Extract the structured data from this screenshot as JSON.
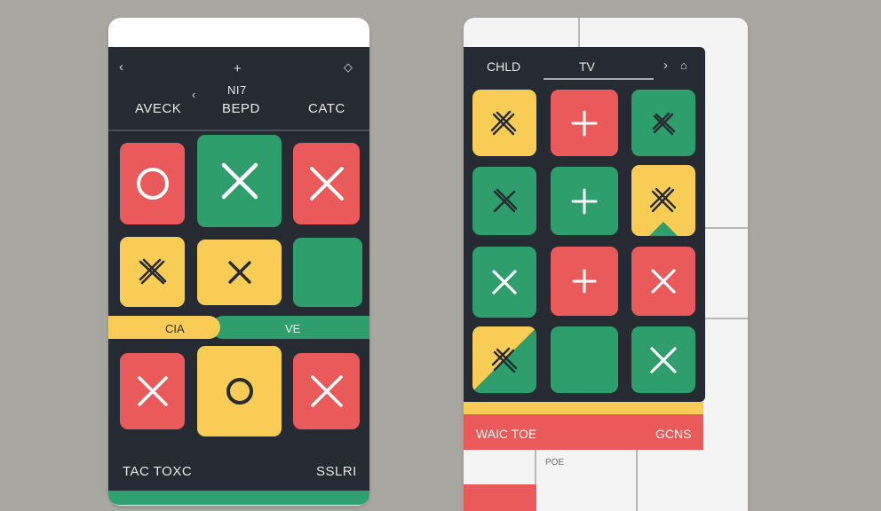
{
  "left_phone": {
    "header": {
      "top_icons": [
        "chevron-left-icon",
        "plus-icon",
        "diamond-icon"
      ],
      "center_text": "NI7",
      "small_icon": "chevron-left-icon",
      "tabs": [
        "AVECK",
        "BEPD",
        "CATC"
      ]
    },
    "board_rows": [
      [
        {
          "color": "red",
          "mark": "O"
        },
        {
          "color": "green",
          "mark": "X"
        },
        {
          "color": "red",
          "mark": "X"
        }
      ],
      [
        {
          "color": "yellow",
          "mark": "scribble-X"
        },
        {
          "color": "yellow",
          "mark": "x"
        },
        {
          "color": "green",
          "mark": ""
        }
      ],
      [
        {
          "color": "red",
          "mark": "X"
        },
        {
          "color": "yellow",
          "mark": "O"
        },
        {
          "color": "red",
          "mark": "X"
        }
      ]
    ],
    "band": {
      "left_label": "CIA",
      "right_label": "VE"
    },
    "footer": {
      "left_label": "TAC TOXC",
      "right_label": "SSLRI"
    }
  },
  "right_phone": {
    "header": {
      "left_label": "CHLD",
      "center_label": "TV",
      "icons": [
        "chevron-right-icon",
        "bell-icon"
      ]
    },
    "board_rows": [
      [
        {
          "color": "yellow",
          "mark": "scribble-X"
        },
        {
          "color": "red",
          "mark": "+"
        },
        {
          "color": "green",
          "mark": "scribble-X"
        }
      ],
      [
        {
          "color": "green",
          "mark": "scribble-X"
        },
        {
          "color": "green",
          "mark": "+"
        },
        {
          "color": "yellow",
          "mark": "scribble-X"
        }
      ],
      [
        {
          "color": "green",
          "mark": "X"
        },
        {
          "color": "red",
          "mark": "+"
        },
        {
          "color": "red",
          "mark": "X"
        }
      ],
      [
        {
          "color": "yellow-green",
          "mark": "scribble-X"
        },
        {
          "color": "green",
          "mark": ""
        },
        {
          "color": "green",
          "mark": "X"
        }
      ]
    ],
    "status_bar": {
      "left_label": "WAIC TOE",
      "right_label": "GCNS"
    },
    "small_label": "POE"
  },
  "colors": {
    "background": "#a9a7a2",
    "panel_dark": "#262b33",
    "red": "#ea5a5a",
    "green": "#2d9e6c",
    "yellow": "#f9cc55"
  }
}
